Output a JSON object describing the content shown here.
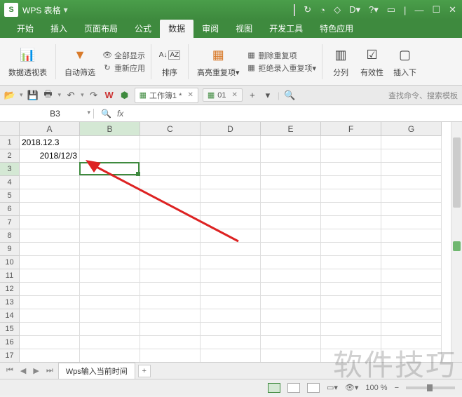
{
  "titlebar": {
    "logo": "S",
    "title": "WPS 表格"
  },
  "menu": {
    "tabs": [
      "开始",
      "插入",
      "页面布局",
      "公式",
      "数据",
      "审阅",
      "视图",
      "开发工具",
      "特色应用"
    ],
    "active_index": 4
  },
  "ribbon": {
    "pivot": "数据透视表",
    "autofilter": "自动筛选",
    "showall": "全部显示",
    "reapply": "重新应用",
    "sort": "排序",
    "highlight_dup": "高亮重复项",
    "remove_dup": "删除重复项",
    "reject_dup": "拒绝录入重复项",
    "split": "分列",
    "validation": "有效性",
    "insert_dd": "插入下"
  },
  "qat": {
    "doc1": "工作簿1 *",
    "doc2": "01",
    "search_placeholder": "查找命令、搜索模板"
  },
  "fbar": {
    "nameref": "B3",
    "fx": "fx"
  },
  "grid": {
    "cols": [
      "A",
      "B",
      "C",
      "D",
      "E",
      "F",
      "G"
    ],
    "rows": 17,
    "cells": {
      "A1": "2018.12.3",
      "A2": "2018/12/3"
    },
    "active": {
      "col": "B",
      "row": 3
    }
  },
  "sheet": {
    "name": "Wps输入当前时间"
  },
  "status": {
    "zoom": "100 %"
  },
  "watermark": "软件技巧"
}
